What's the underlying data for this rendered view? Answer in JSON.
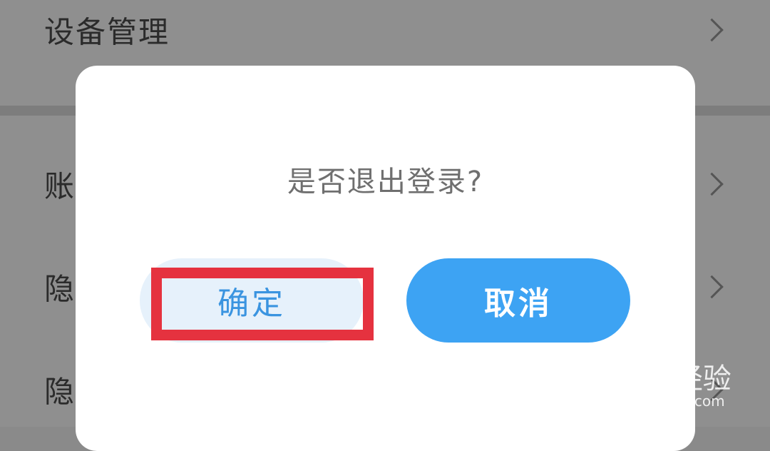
{
  "background": {
    "rows": [
      {
        "label": "设备管理"
      },
      {
        "label": "账"
      },
      {
        "label": "隐"
      },
      {
        "label": "隐"
      }
    ]
  },
  "dialog": {
    "message": "是否退出登录?",
    "confirm_label": "确定",
    "cancel_label": "取消"
  },
  "watermark": {
    "brand": "Baidu经验",
    "url": "jingyan.baidu.com"
  },
  "colors": {
    "highlight": "#e5323f",
    "cancel_bg": "#3da3f3",
    "confirm_text": "#3a94e0"
  }
}
